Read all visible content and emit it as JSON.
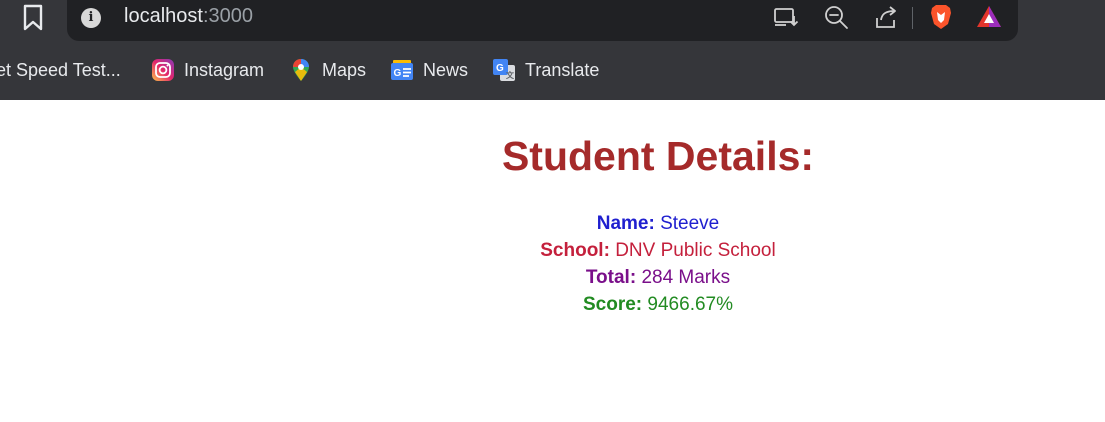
{
  "browser": {
    "url_host": "localhost",
    "url_port": ":3000",
    "bookmarks": [
      {
        "label": "et Speed Test...",
        "icon": "speedtest-icon"
      },
      {
        "label": "Instagram",
        "icon": "instagram-icon"
      },
      {
        "label": "Maps",
        "icon": "maps-icon"
      },
      {
        "label": "News",
        "icon": "news-icon"
      },
      {
        "label": "Translate",
        "icon": "translate-icon"
      }
    ],
    "colors": {
      "toolbar_bg": "#35363a",
      "urlbar_bg": "#202124",
      "text": "#e8eaed"
    }
  },
  "page": {
    "title": "Student Details:",
    "name_label": "Name:",
    "name_value": "Steeve",
    "school_label": "School:",
    "school_value": "DNV Public School",
    "total_label": "Total:",
    "total_value": "284 Marks",
    "score_label": "Score:",
    "score_value": "9466.67%",
    "colors": {
      "title": "#a52a2a",
      "name": "#1f1fcf",
      "school": "#c4203c",
      "total": "#7a0f8a",
      "score": "#228b22"
    }
  }
}
